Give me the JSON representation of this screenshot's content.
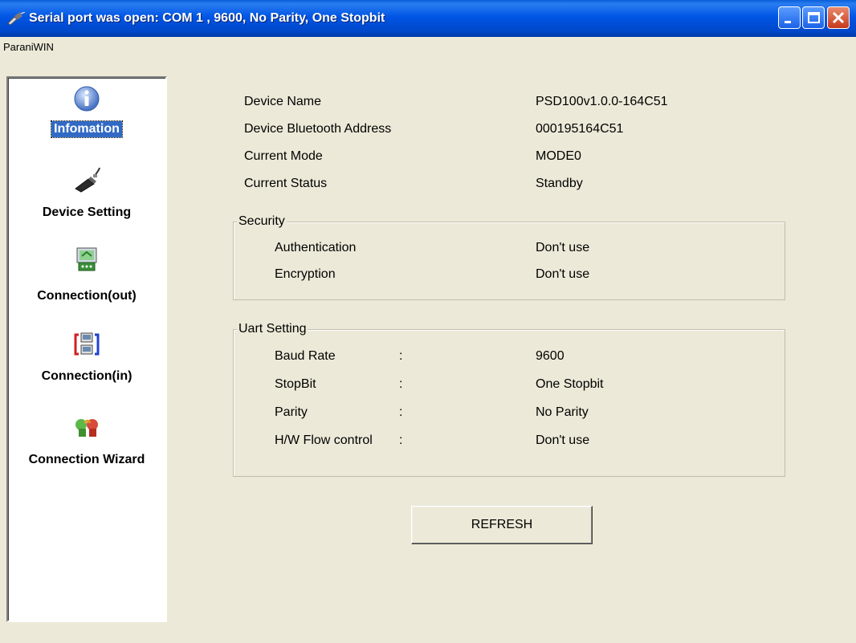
{
  "window": {
    "title": "Serial port was open: COM 1 , 9600, No Parity, One Stopbit"
  },
  "menubar": {
    "item": "ParaniWIN"
  },
  "sidebar": {
    "items": [
      {
        "label": "Infomation",
        "icon": "info-icon",
        "active": true
      },
      {
        "label": "Device Setting",
        "icon": "device-icon",
        "active": false
      },
      {
        "label": "Connection(out)",
        "icon": "connection-out-icon",
        "active": false
      },
      {
        "label": "Connection(in)",
        "icon": "connection-in-icon",
        "active": false
      },
      {
        "label": "Connection Wizard",
        "icon": "wizard-icon",
        "active": false
      }
    ]
  },
  "info": {
    "device_name": {
      "label": "Device Name",
      "value": "PSD100v1.0.0-164C51"
    },
    "bt_address": {
      "label": "Device Bluetooth Address",
      "value": "000195164C51"
    },
    "current_mode": {
      "label": "Current Mode",
      "value": "MODE0"
    },
    "current_status": {
      "label": "Current Status",
      "value": "Standby"
    }
  },
  "security": {
    "title": "Security",
    "authentication": {
      "label": "Authentication",
      "value": "Don't use"
    },
    "encryption": {
      "label": "Encryption",
      "value": "Don't use"
    }
  },
  "uart": {
    "title": "Uart Setting",
    "baud_rate": {
      "label": "Baud Rate",
      "sep": ":",
      "value": "9600"
    },
    "stopbit": {
      "label": "StopBit",
      "sep": ":",
      "value": "One Stopbit"
    },
    "parity": {
      "label": "Parity",
      "sep": ":",
      "value": "No Parity"
    },
    "flow": {
      "label": "H/W Flow control",
      "sep": ":",
      "value": "Don't use"
    }
  },
  "refresh_label": "REFRESH"
}
